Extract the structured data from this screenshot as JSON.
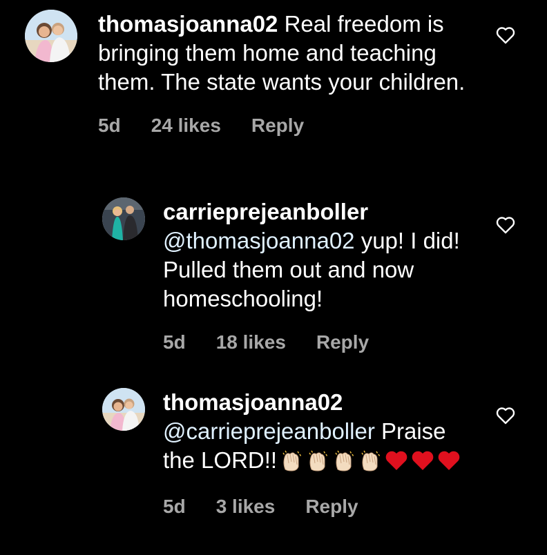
{
  "comments": [
    {
      "username": "thomasjoanna02",
      "mention": "",
      "text": " Real freedom is bringing them home and teaching them. The state wants your children.",
      "time": "5d",
      "likes": "24 likes",
      "reply_label": "Reply",
      "avatar_icon": "profile-photo-couple"
    },
    {
      "username": "carrieprejeanboller",
      "mention": "@thomasjoanna02",
      "text": " yup! I did! Pulled them out and now homeschooling!",
      "time": "5d",
      "likes": "18 likes",
      "reply_label": "Reply",
      "avatar_icon": "profile-photo-couple-event"
    },
    {
      "username": "thomasjoanna02",
      "mention": "@carrieprejeanboller",
      "text": " Praise the LORD!!",
      "emojis": [
        "clapping-hands",
        "clapping-hands",
        "clapping-hands",
        "clapping-hands",
        "red-heart",
        "red-heart",
        "red-heart"
      ],
      "time": "5d",
      "likes": "3 likes",
      "reply_label": "Reply",
      "avatar_icon": "profile-photo-couple"
    }
  ],
  "colors": {
    "background": "#000000",
    "text": "#ffffff",
    "mention": "#e0f1ff",
    "meta": "#a8a8a8",
    "heart_emoji": "#e0101e"
  }
}
